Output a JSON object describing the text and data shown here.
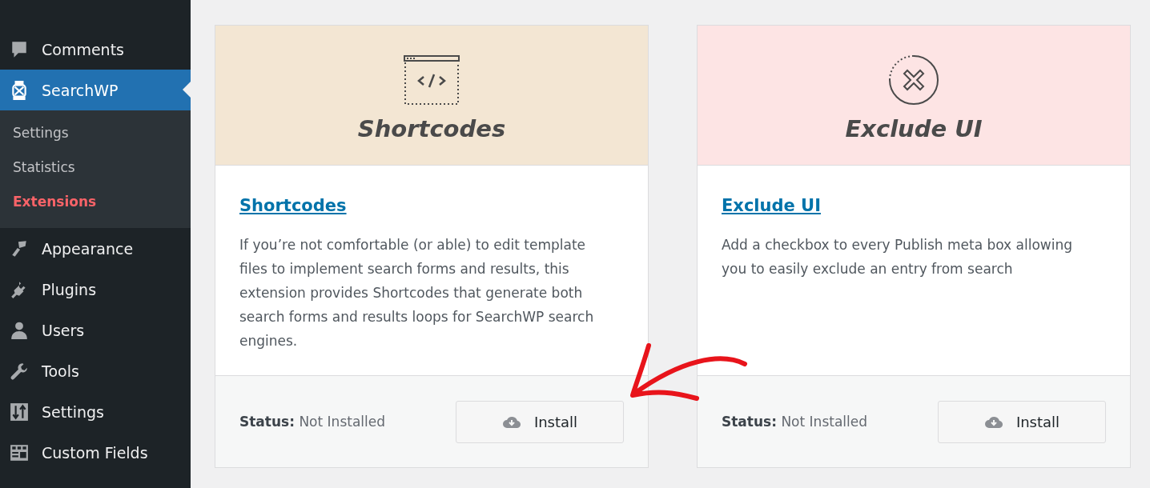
{
  "sidebar": {
    "items": [
      {
        "label": "Comments",
        "kind": "comment",
        "selected": false
      },
      {
        "label": "SearchWP",
        "kind": "lantern",
        "selected": true,
        "children": [
          {
            "label": "Settings",
            "selected": false
          },
          {
            "label": "Statistics",
            "selected": false
          },
          {
            "label": "Extensions",
            "selected": true
          }
        ]
      },
      {
        "label": "Appearance",
        "kind": "brush",
        "selected": false
      },
      {
        "label": "Plugins",
        "kind": "plug",
        "selected": false
      },
      {
        "label": "Users",
        "kind": "user",
        "selected": false
      },
      {
        "label": "Tools",
        "kind": "wrench",
        "selected": false
      },
      {
        "label": "Settings",
        "kind": "sliders",
        "selected": false
      },
      {
        "label": "Custom Fields",
        "kind": "table",
        "selected": false
      }
    ]
  },
  "extensions": [
    {
      "banner_title": "Shortcodes",
      "kind": "code",
      "color": "#f3e6d3",
      "title": "Shortcodes",
      "description": "If you’re not comfortable (or able) to edit template files to implement search forms and results, this extension provides Shortcodes that generate both search forms and results loops for SearchWP search engines.",
      "status": "**Status:** Not Installed",
      "button": "Install"
    },
    {
      "banner_title": "Exclude UI",
      "kind": "exclude",
      "color": "#fde4e4",
      "title": "Exclude UI",
      "description": "Add a checkbox to every Publish meta box allowing you to easily exclude an entry from search",
      "status": "**Status:** Not Installed",
      "button": "Install"
    }
  ]
}
